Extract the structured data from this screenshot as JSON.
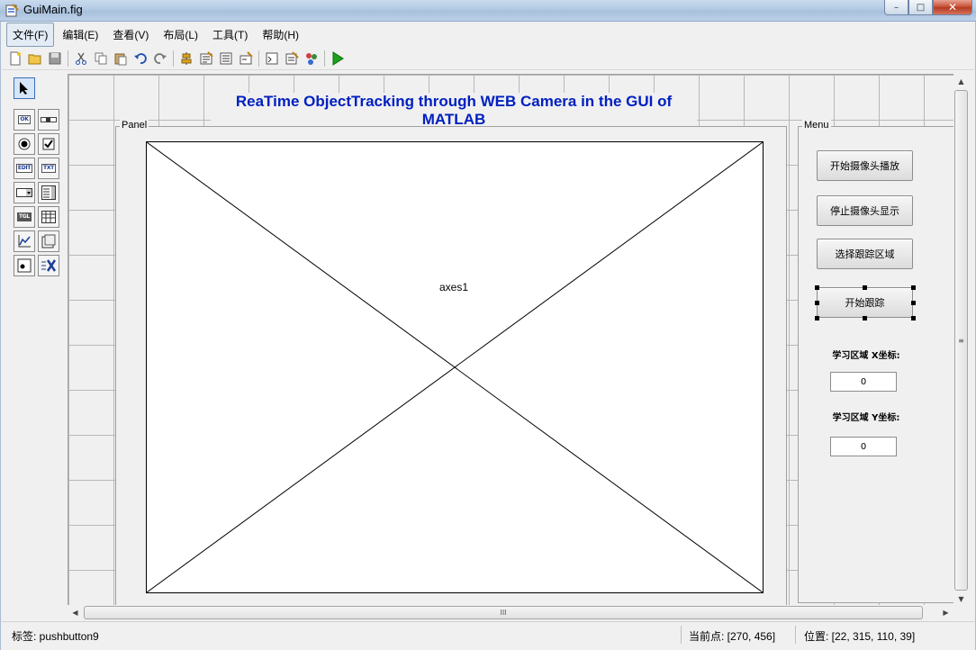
{
  "window": {
    "title": "GuiMain.fig",
    "minimize": "–",
    "maximize": "□",
    "close": "✕"
  },
  "menu": [
    "文件(F)",
    "编辑(E)",
    "查看(V)",
    "布局(L)",
    "工具(T)",
    "帮助(H)"
  ],
  "toolbar": {
    "icons": [
      "new-icon",
      "open-icon",
      "save-icon",
      "cut-icon",
      "copy-icon",
      "paste-icon",
      "undo-icon",
      "redo-icon",
      "align-icon",
      "menu-editor-icon",
      "tab-order-icon",
      "toolbar-editor-icon",
      "mfile-editor-icon",
      "property-inspector-icon",
      "object-browser-icon",
      "run-icon"
    ]
  },
  "palette": {
    "pushbutton_tag": "OK",
    "edit_tag": "EDIT",
    "text_tag": "TXT",
    "toggle_tag": "TGL"
  },
  "canvas": {
    "gui_title": "ReaTime ObjectTracking through WEB Camera in the GUI of MATLAB",
    "panel_label": "Panel",
    "axes_label": "axes1",
    "menu_label": "Menu",
    "buttons": [
      "开始摄像头播放",
      "停止摄像头显示",
      "选择跟踪区域",
      "开始跟踪"
    ],
    "x_label": "学习区域 X坐标:",
    "x_value": "0",
    "y_label": "学习区域 Y坐标:",
    "y_value": "0"
  },
  "scroll": {
    "grip": "≡",
    "hgrip": "III"
  },
  "status": {
    "tag": "标签: pushbutton9",
    "current_point": "当前点:  [270, 456]",
    "position": "位置: [22, 315, 110, 39]"
  }
}
